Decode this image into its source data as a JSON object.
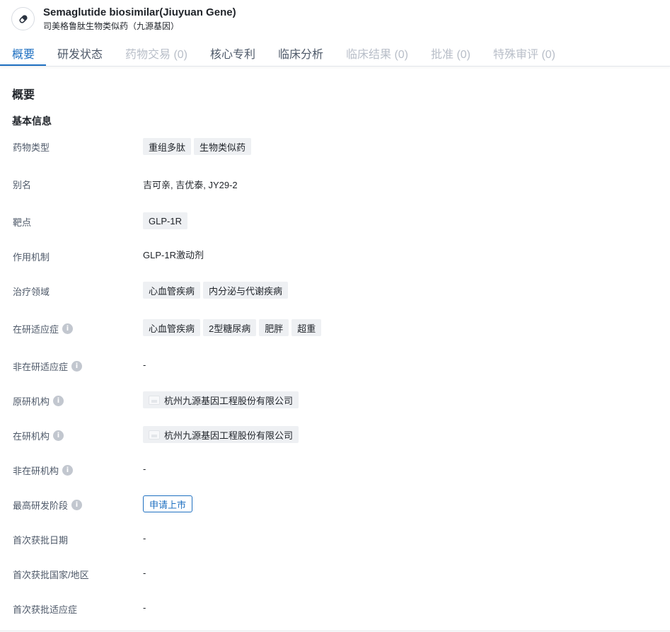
{
  "header": {
    "icon": "pill-icon",
    "title_en": "Semaglutide biosimilar(Jiuyuan Gene)",
    "title_cn": "司美格鲁肽生物类似药（九源基因）"
  },
  "tabs": [
    {
      "label": "概要",
      "state": "active"
    },
    {
      "label": "研发状态",
      "state": "enabled"
    },
    {
      "label": "药物交易 (0)",
      "state": "disabled"
    },
    {
      "label": "核心专利",
      "state": "enabled"
    },
    {
      "label": "临床分析",
      "state": "enabled"
    },
    {
      "label": "临床结果 (0)",
      "state": "disabled"
    },
    {
      "label": "批准 (0)",
      "state": "disabled"
    },
    {
      "label": "特殊审评 (0)",
      "state": "disabled"
    }
  ],
  "section_title": "概要",
  "basic_info_title": "基本信息",
  "rows": {
    "drug_type": {
      "label": "药物类型",
      "tags": [
        "重组多肽",
        "生物类似药"
      ]
    },
    "alias": {
      "label": "别名",
      "value": "吉可亲,  吉优泰,  JY29-2"
    },
    "target": {
      "label": "靶点",
      "tags": [
        "GLP-1R"
      ]
    },
    "mechanism": {
      "label": "作用机制",
      "value": "GLP-1R激动剂"
    },
    "therapeutic_area": {
      "label": "治疗领域",
      "tags": [
        "心血管疾病",
        "内分泌与代谢疾病"
      ]
    },
    "active_indication": {
      "label": "在研适应症",
      "tags": [
        "心血管疾病",
        "2型糖尿病",
        "肥胖",
        "超重"
      ]
    },
    "inactive_indication": {
      "label": "非在研适应症",
      "value": "-"
    },
    "originator": {
      "label": "原研机构",
      "org": "杭州九源基因工程股份有限公司"
    },
    "active_org": {
      "label": "在研机构",
      "org": "杭州九源基因工程股份有限公司"
    },
    "inactive_org": {
      "label": "非在研机构",
      "value": "-"
    },
    "highest_phase": {
      "label": "最高研发阶段",
      "stage": "申请上市"
    },
    "first_approval_date": {
      "label": "首次获批日期",
      "value": "-"
    },
    "first_approval_country": {
      "label": "首次获批国家/地区",
      "value": "-"
    },
    "first_approval_indication": {
      "label": "首次获批适应症",
      "value": "-"
    }
  },
  "colors": {
    "accent": "#1f70c1",
    "tag_bg": "#eef0f3",
    "disabled_text": "#b8bec8",
    "label_text": "#4e5969"
  }
}
